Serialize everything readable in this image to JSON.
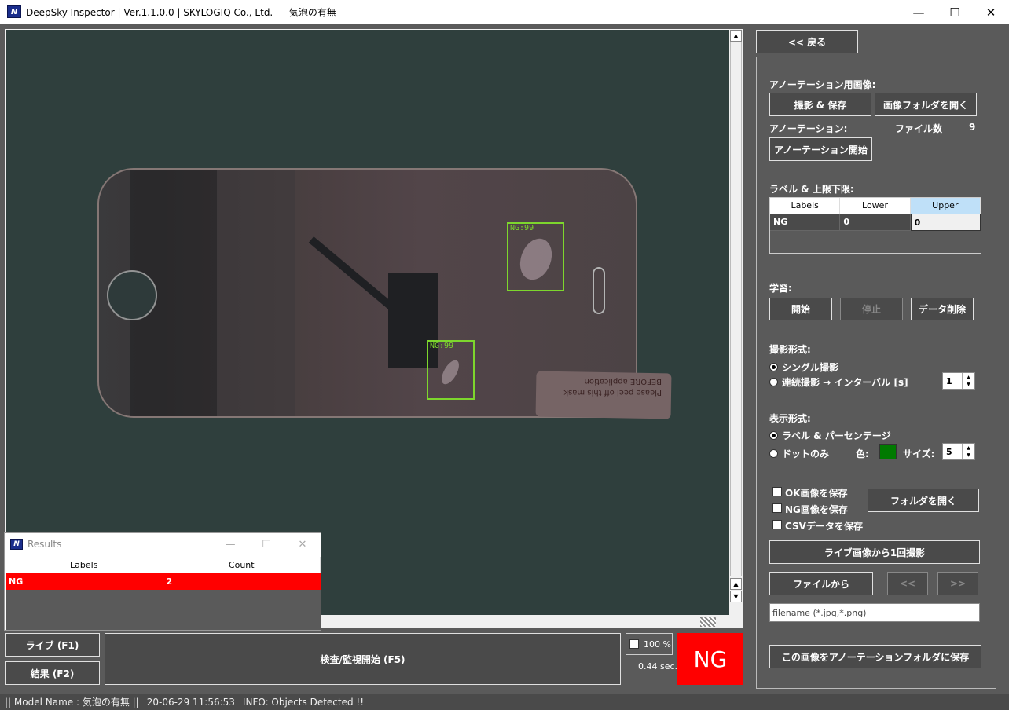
{
  "window": {
    "title": "DeepSky Inspector | Ver.1.1.0.0 | SKYLOGIQ Co., Ltd. --- 気泡の有無",
    "app_icon": "N"
  },
  "viewer": {
    "detections": [
      {
        "label": "NG:99"
      },
      {
        "label": "NG:99"
      }
    ],
    "sticker_text": "Please peel off this mask BEFORE application"
  },
  "results_window": {
    "title": "Results",
    "columns": [
      "Labels",
      "Count"
    ],
    "rows": [
      {
        "label": "NG",
        "count": "2"
      }
    ]
  },
  "bottom": {
    "live_button": "ライブ (F1)",
    "result_button": "結果 (F2)",
    "inspect_button": "検査/監視開始 (F5)",
    "zoom_label": "100 %",
    "timing": "0.44 sec.",
    "verdict": "NG",
    "verdict_color": "#ff0000"
  },
  "statusbar": {
    "model": "|| Model Name : 気泡の有無 ||",
    "timestamp": "20-06-29 11:56:53",
    "info": "INFO:   Objects Detected !!"
  },
  "panel": {
    "back_button": "<< 戻る",
    "annotation_images_label": "アノーテーション用画像:",
    "capture_save_button": "撮影 & 保存",
    "open_image_folder_button": "画像フォルダを開く",
    "annotation_label": "アノーテーション:",
    "file_count_label": "ファイル数",
    "file_count": "9",
    "annotation_start_button": "アノーテーション開始",
    "label_limits_label": "ラベル & 上限下限:",
    "label_table": {
      "columns": [
        "Labels",
        "Lower",
        "Upper"
      ],
      "rows": [
        {
          "label": "NG",
          "lower": "0",
          "upper": "0"
        }
      ]
    },
    "learning_label": "学習:",
    "learn_start_button": "開始",
    "learn_stop_button": "停止",
    "data_delete_button": "データ削除",
    "capture_mode_label": "撮影形式:",
    "capture_single": "シングル撮影",
    "capture_continuous": "連続撮影 → インターバル [s]",
    "interval_value": "1",
    "display_mode_label": "表示形式:",
    "display_label_pct": "ラベル & パーセンテージ",
    "display_dot": "ドットのみ",
    "color_label": "色:",
    "dot_color": "#007a00",
    "size_label": "サイズ:",
    "size_value": "5",
    "save_ok": "OK画像を保存",
    "save_ng": "NG画像を保存",
    "save_csv": "CSVデータを保存",
    "open_folder_button": "フォルダを開く",
    "capture_once_button": "ライブ画像から1回撮影",
    "from_file_button": "ファイルから",
    "prev_button": "<<",
    "next_button": ">>",
    "filename_placeholder": "filename (*.jpg,*.png)",
    "save_to_annotation_button": "この画像をアノーテーションフォルダに保存"
  }
}
